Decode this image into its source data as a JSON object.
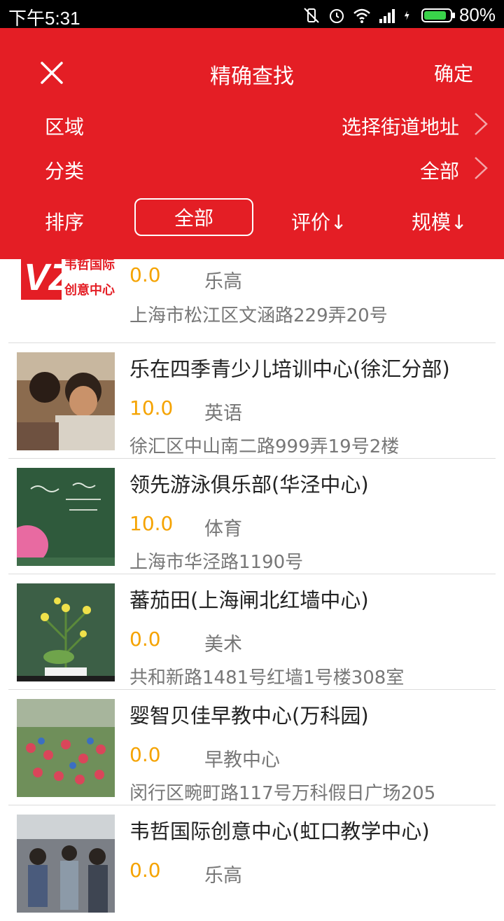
{
  "status_bar": {
    "time": "下午5:31",
    "battery": "80%",
    "battery_level": 0.8,
    "icons": [
      "vibrate-off-icon",
      "alarm-icon",
      "wifi-icon",
      "signal-icon",
      "charging-icon",
      "battery-icon"
    ]
  },
  "header": {
    "close_icon": "close-icon",
    "title": "精确查找",
    "confirm": "确定"
  },
  "filters": {
    "region_label": "区域",
    "region_value": "选择街道地址",
    "category_label": "分类",
    "category_value": "全部",
    "sort_label": "排序",
    "sort_all": "全部",
    "sort_rating": "评价↓",
    "sort_scale": "规模↓"
  },
  "colors": {
    "primary": "#e41e25",
    "score": "#f5a300",
    "text_main": "#222222",
    "text_sub": "#777777"
  },
  "list": {
    "items": [
      {
        "name": "",
        "score": "0.0",
        "category": "乐高",
        "address": "上海市松江区文涵路229弄20号",
        "thumb": "logo-vz-image"
      },
      {
        "name": "乐在四季青少儿培训中心(徐汇分部)",
        "score": "10.0",
        "category": "英语",
        "address": "徐汇区中山南二路999弄19号2楼",
        "thumb": "students-photo"
      },
      {
        "name": "领先游泳俱乐部(华泾中心)",
        "score": "10.0",
        "category": "体育",
        "address": "上海市华泾路1190号",
        "thumb": "blackboard-photo"
      },
      {
        "name": "蕃茄田(上海闸北红墙中心)",
        "score": "0.0",
        "category": "美术",
        "address": "共和新路1481号红墙1号楼308室",
        "thumb": "flower-photo"
      },
      {
        "name": "婴智贝佳早教中心(万科园)",
        "score": "0.0",
        "category": "早教中心",
        "address": "闵行区畹町路117号万科假日广场205",
        "thumb": "children-lawn-photo"
      },
      {
        "name": "韦哲国际创意中心(虹口教学中心)",
        "score": "0.0",
        "category": "乐高",
        "address": "",
        "thumb": "classroom-photo"
      }
    ]
  }
}
